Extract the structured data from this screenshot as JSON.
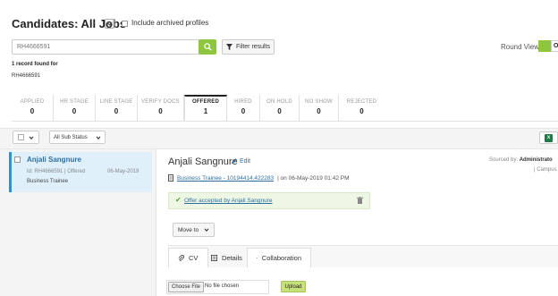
{
  "header": {
    "title": "Candidates: All Jobs",
    "include_archived_label": "Include archived profiles"
  },
  "search": {
    "value": "RH4666591",
    "filter_label": "Filter results"
  },
  "round_view": {
    "label": "Round View:",
    "toggle_text": "O"
  },
  "results": {
    "found_text": "1 record found for",
    "query_text": "RH4666591"
  },
  "stages": [
    {
      "label": "APPLIED",
      "count": "0"
    },
    {
      "label": "HR STAGE",
      "count": "0"
    },
    {
      "label": "LINE STAGE",
      "count": "0"
    },
    {
      "label": "VERIFY DOCS",
      "count": "0"
    },
    {
      "label": "OFFERED",
      "count": "1"
    },
    {
      "label": "HIRED",
      "count": "0"
    },
    {
      "label": "ON HOLD",
      "count": "0"
    },
    {
      "label": "NO SHOW",
      "count": "0"
    },
    {
      "label": "REJECTED",
      "count": "0"
    }
  ],
  "toolbar": {
    "sub_status_label": "All Sub Status"
  },
  "candidate_list": [
    {
      "name": "Anjali Sangnure",
      "meta": "Id: RH4666591  |  Offered",
      "date": "06-May-2019",
      "job": "Business Trainee"
    }
  ],
  "detail": {
    "name": "Anjali Sangnure",
    "edit_label": "Edit",
    "sourced_prefix": "Sourced by:",
    "sourced_by": "Administrato",
    "sourced_sub": "| Campus",
    "job_link": "Business Trainee - 10194414.422283",
    "job_suffix": "| on 06-May-2019 01:42 PM",
    "offer_text": "Offer accepted by Anjali Sangnure",
    "move_to_label": "Move to",
    "tabs": {
      "cv": "CV",
      "details": "Details",
      "collaboration": "Collaboration"
    },
    "file": {
      "choose_label": "Choose File",
      "none_label": "No file chosen",
      "upload_label": "Upload"
    }
  },
  "colors": {
    "accent_green": "#8ec63f",
    "link_blue": "#2d6fa3",
    "selected_bg": "#dff0fb"
  }
}
